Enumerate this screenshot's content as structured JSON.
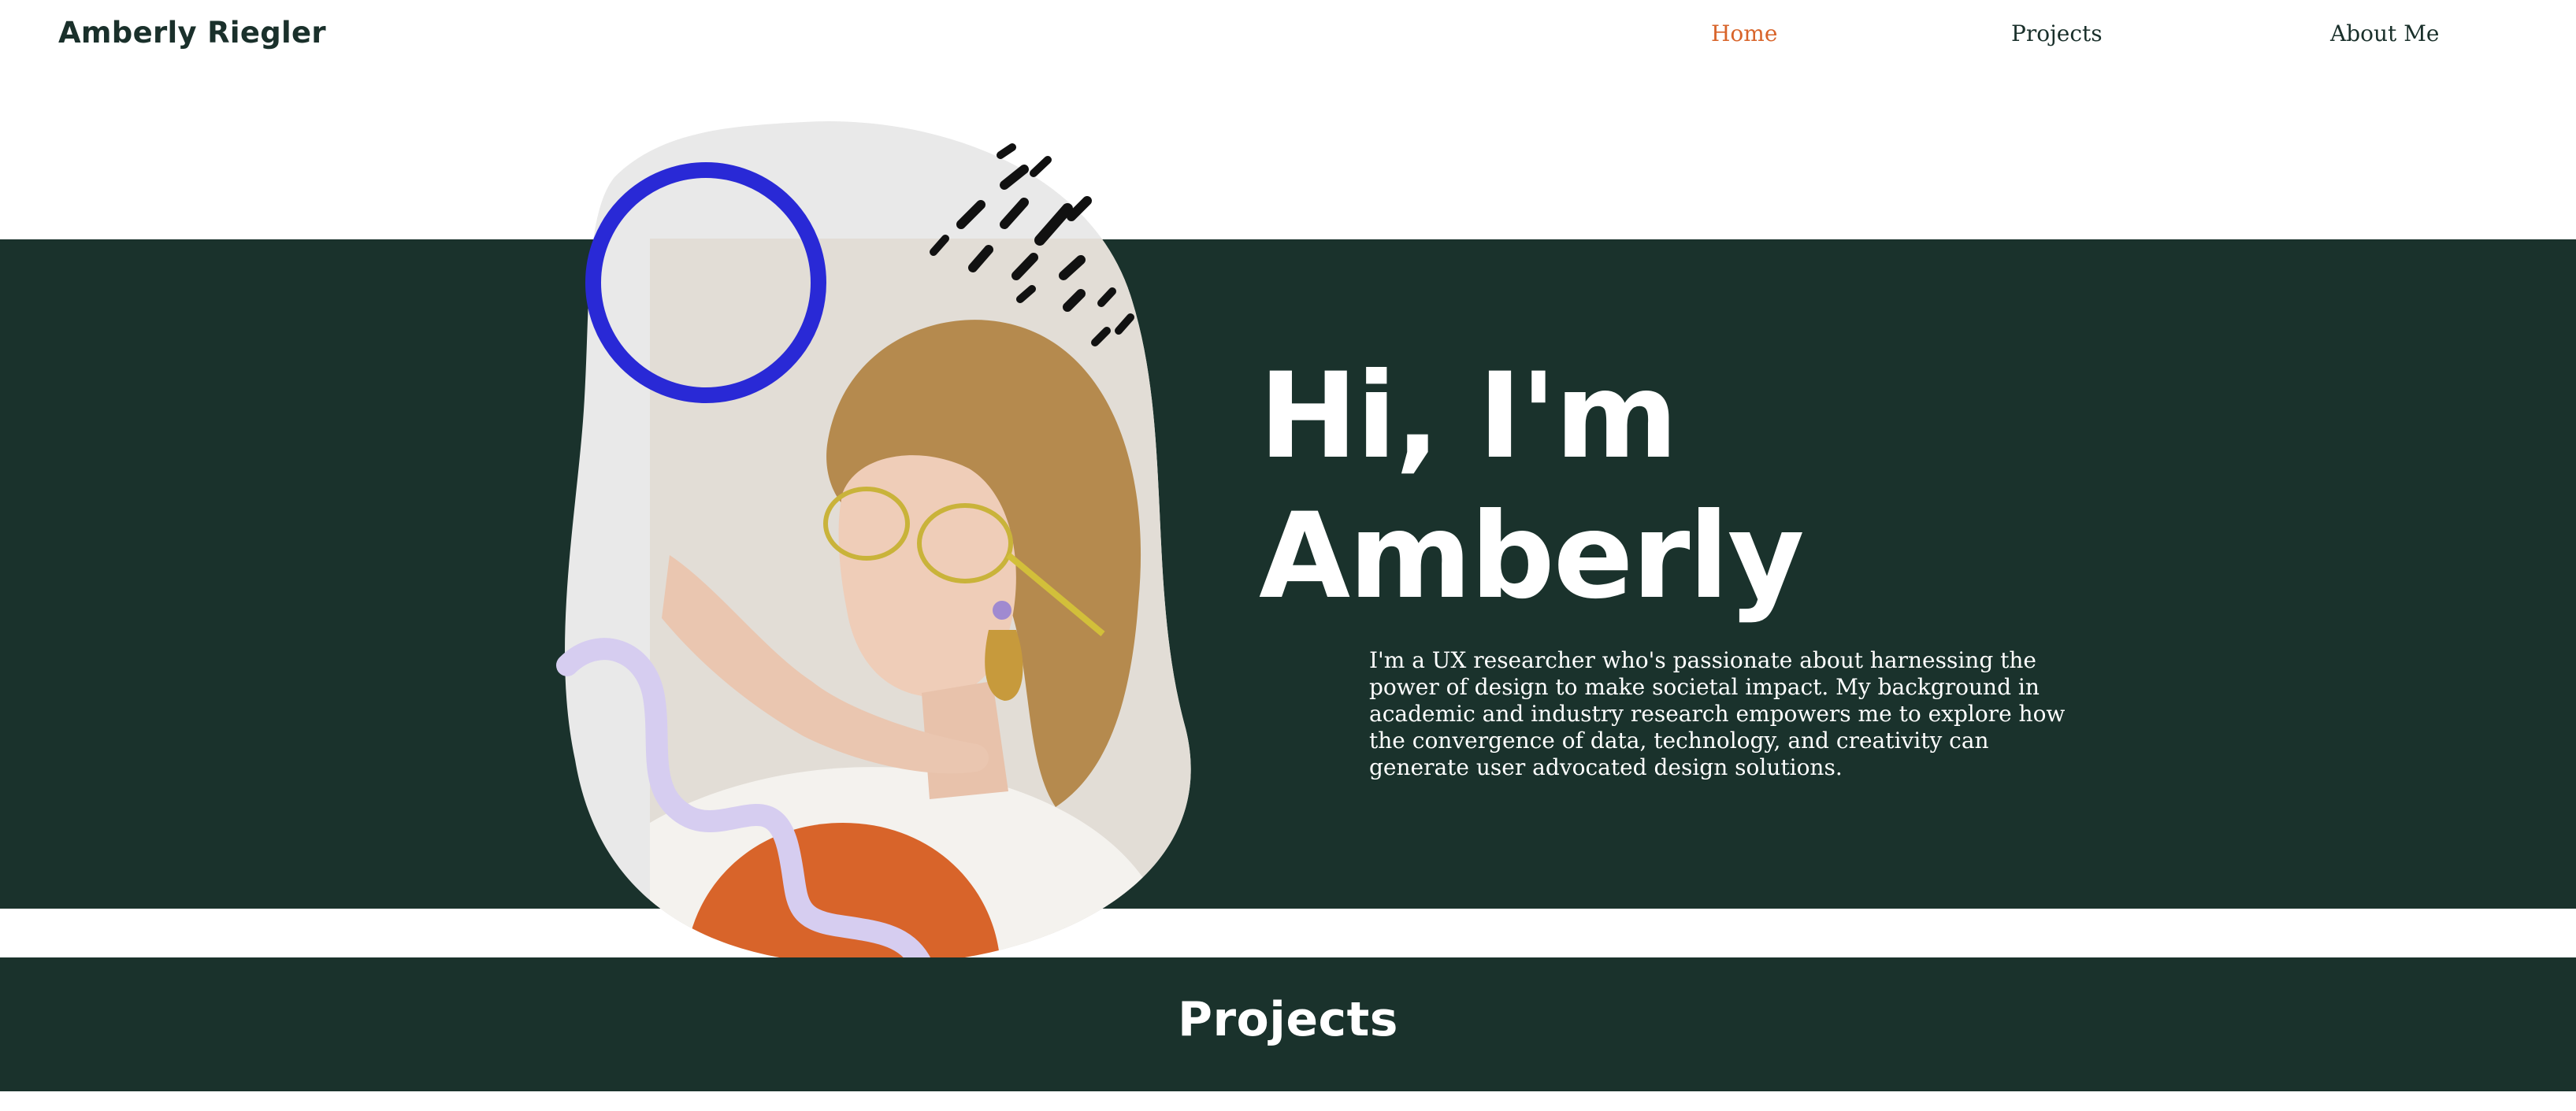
{
  "header": {
    "brand": "Amberly Riegler",
    "nav": [
      {
        "label": "Home",
        "active": true
      },
      {
        "label": "Projects",
        "active": false
      },
      {
        "label": "About Me",
        "active": false
      }
    ]
  },
  "hero": {
    "title_line1": "Hi, I'm",
    "title_line2": "Amberly",
    "bio": "I'm a UX researcher who's passionate about harnessing the power of design to make societal impact. My background in academic and industry research empowers me to explore how the convergence of data, technology, and creativity can generate user advocated design solutions."
  },
  "projects_section": {
    "heading": "Projects"
  },
  "colors": {
    "dark_green": "#1a322c",
    "accent_orange": "#d8642a",
    "blob_gray": "#e9e9e9",
    "ring_blue": "#2929d6",
    "squiggle_lavender": "#d6cdf0"
  }
}
